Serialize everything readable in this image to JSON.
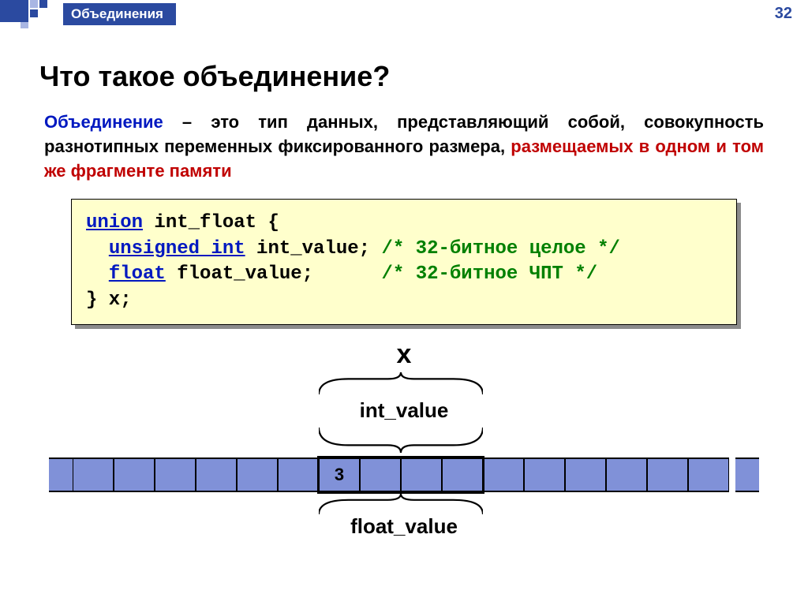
{
  "header": {
    "breadcrumb": "Объединения",
    "page_number": "32"
  },
  "title": "Что такое объединение?",
  "definition": {
    "term": "Объединение",
    "plain_text": " – это тип данных, представляющий собой, совокупность разнотипных переменных фиксированного размера, ",
    "emph": "размещаемых в одном и том же фрагменте памяти"
  },
  "code": {
    "l1_kw": "union",
    "l1_rest": " int_float {",
    "l2_pad": "  ",
    "l2_kw": "unsigned int",
    "l2_rest": " int_value; ",
    "l2_cmt": "/* 32-битное целое */",
    "l3_pad": "  ",
    "l3_kw": "float",
    "l3_rest": " float_value;      ",
    "l3_cmt": "/* 32-битное ЧПТ */",
    "l4": "} x;"
  },
  "diagram": {
    "label_x": "x",
    "label_int": "int_value",
    "label_float": "float_value",
    "cell_value": "3",
    "total_cells": 16,
    "group_start": 6,
    "group_size": 4,
    "value_cell_offset": 0
  }
}
